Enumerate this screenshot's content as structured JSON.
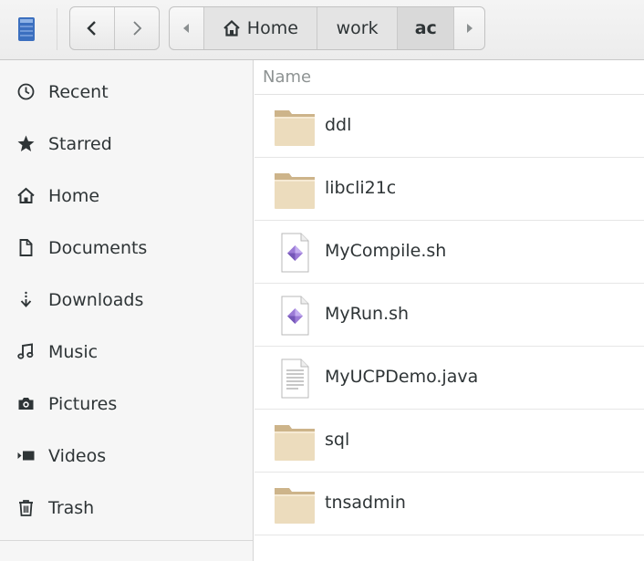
{
  "toolbar": {
    "app_icon": "files-app-icon",
    "back_icon": "chevron-left-icon",
    "forward_icon": "chevron-right-icon"
  },
  "pathbar": {
    "crumbs": [
      {
        "label": "Home",
        "icon": "home-icon"
      },
      {
        "label": "work"
      },
      {
        "label": "ac",
        "active": true
      }
    ]
  },
  "sidebar": {
    "items": [
      {
        "label": "Recent",
        "icon": "clock-icon"
      },
      {
        "label": "Starred",
        "icon": "star-icon"
      },
      {
        "label": "Home",
        "icon": "home-icon"
      },
      {
        "label": "Documents",
        "icon": "document-icon"
      },
      {
        "label": "Downloads",
        "icon": "download-icon"
      },
      {
        "label": "Music",
        "icon": "music-icon"
      },
      {
        "label": "Pictures",
        "icon": "camera-icon"
      },
      {
        "label": "Videos",
        "icon": "video-icon"
      },
      {
        "label": "Trash",
        "icon": "trash-icon"
      }
    ]
  },
  "filelist": {
    "column_name": "Name",
    "files": [
      {
        "name": "ddl",
        "type": "folder"
      },
      {
        "name": "libcli21c",
        "type": "folder"
      },
      {
        "name": "MyCompile.sh",
        "type": "script"
      },
      {
        "name": "MyRun.sh",
        "type": "script"
      },
      {
        "name": "MyUCPDemo.java",
        "type": "text"
      },
      {
        "name": "sql",
        "type": "folder"
      },
      {
        "name": "tnsadmin",
        "type": "folder"
      }
    ]
  },
  "colors": {
    "folder": "#e8d4b0",
    "script_diamond": "#8f6fd0",
    "app_icon": "#4a7fc8"
  }
}
